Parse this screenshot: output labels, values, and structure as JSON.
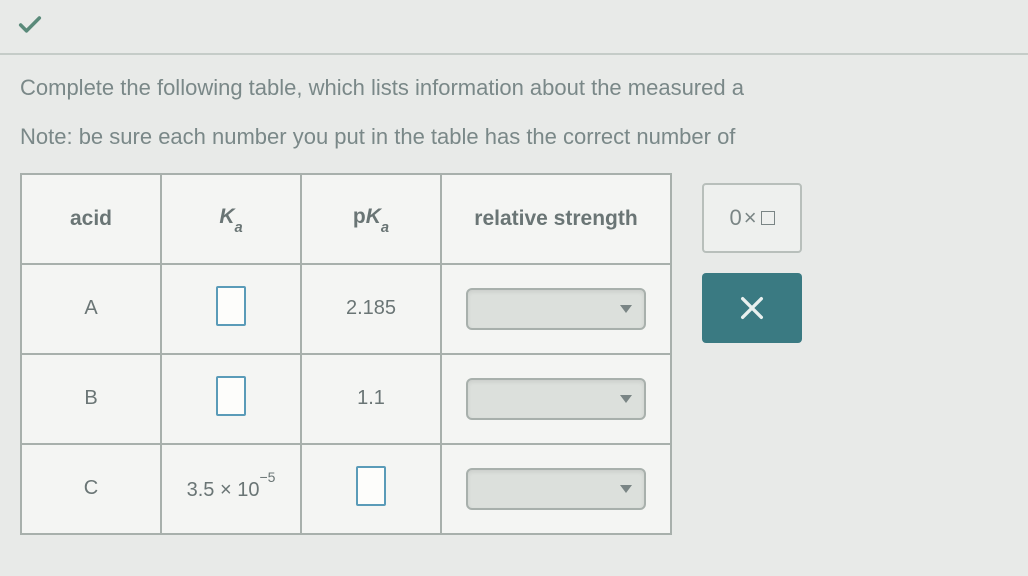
{
  "instructions": {
    "line1": "Complete the following table, which lists information about the measured a",
    "line2": "Note: be sure each number you put in the table has the correct number of"
  },
  "table": {
    "headers": {
      "col1": "acid",
      "col2_base": "K",
      "col2_sub": "a",
      "col3_prefix": "p",
      "col3_base": "K",
      "col3_sub": "a",
      "col4": "relative strength"
    },
    "rows": [
      {
        "acid": "A",
        "ka": "",
        "pka": "2.185",
        "strength": ""
      },
      {
        "acid": "B",
        "ka": "",
        "pka": "1.1",
        "strength": ""
      },
      {
        "acid": "C",
        "ka_base": "3.5 × 10",
        "ka_exp": "−5",
        "pka": "",
        "strength": ""
      }
    ]
  },
  "format_label_base": "0",
  "format_label_symbol": "×"
}
